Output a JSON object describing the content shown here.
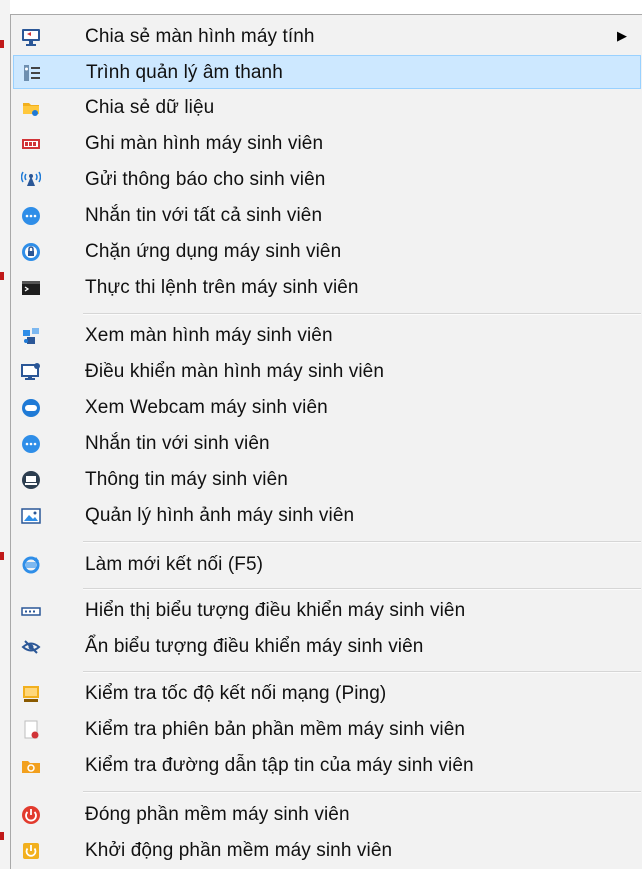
{
  "menu": {
    "items": [
      {
        "label": "Chia sẻ màn hình máy tính",
        "icon": "screen-share-icon",
        "submenu": true
      },
      {
        "label": "Trình quản lý âm thanh",
        "icon": "audio-manager-icon",
        "highlighted": true
      },
      {
        "label": "Chia sẻ dữ liệu",
        "icon": "folder-share-icon"
      },
      {
        "label": "Ghi màn hình máy sinh viên",
        "icon": "screen-record-icon"
      },
      {
        "label": "Gửi thông báo cho sinh viên",
        "icon": "broadcast-icon"
      },
      {
        "label": "Nhắn tin với tất cả sinh viên",
        "icon": "chat-all-icon"
      },
      {
        "label": "Chặn ứng dụng máy sinh viên",
        "icon": "block-app-icon"
      },
      {
        "label": "Thực thi lệnh trên máy sinh viên",
        "icon": "terminal-icon"
      },
      {
        "label": "Xem màn hình máy sinh viên",
        "icon": "view-screen-icon"
      },
      {
        "label": "Điều khiển màn hình máy sinh viên",
        "icon": "remote-control-icon"
      },
      {
        "label": "Xem Webcam máy sinh viên",
        "icon": "webcam-icon"
      },
      {
        "label": "Nhắn tin với sinh viên",
        "icon": "chat-icon"
      },
      {
        "label": "Thông tin máy sinh viên",
        "icon": "machine-info-icon"
      },
      {
        "label": "Quản lý hình ảnh máy sinh viên",
        "icon": "image-manager-icon"
      },
      {
        "label": "Làm mới kết nối (F5)",
        "icon": "refresh-icon"
      },
      {
        "label": "Hiển thị biểu tượng điều khiển máy sinh viên",
        "icon": "show-toolbar-icon"
      },
      {
        "label": "Ẩn biểu tượng điều khiển máy sinh viên",
        "icon": "hide-eye-icon"
      },
      {
        "label": "Kiểm tra tốc độ kết nối mạng (Ping)",
        "icon": "ping-icon"
      },
      {
        "label": "Kiểm tra phiên bản phần mềm máy sinh viên",
        "icon": "version-check-icon"
      },
      {
        "label": "Kiểm tra đường dẫn tập tin của máy sinh viên",
        "icon": "file-path-icon"
      },
      {
        "label": "Đóng phần mềm máy sinh viên",
        "icon": "power-off-icon"
      },
      {
        "label": "Khởi động phần mềm máy sinh viên",
        "icon": "start-app-icon"
      }
    ]
  },
  "colors": {
    "menu_background": "#f2f2f2",
    "highlight_background": "#cde8ff",
    "highlight_border": "#99d1ff",
    "separator": "#d6d6d6"
  }
}
